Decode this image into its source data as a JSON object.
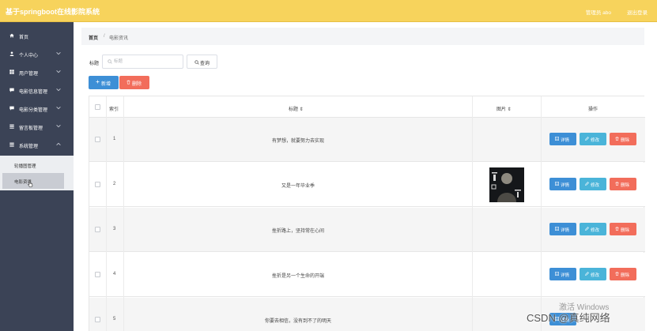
{
  "header": {
    "title": "基于springboot在线影院系统",
    "user_text": "管理员 abo",
    "logout_label": "退出登录",
    "background_color": "#f7d35c"
  },
  "sidebar": {
    "background_color": "#3b4356",
    "items": [
      {
        "label": "首页",
        "icon": "home-icon",
        "has_chevron": false
      },
      {
        "label": "个人中心",
        "icon": "user-icon",
        "has_chevron": true
      },
      {
        "label": "用户管理",
        "icon": "grid-icon",
        "has_chevron": true
      },
      {
        "label": "电影信息管理",
        "icon": "message-icon",
        "has_chevron": true
      },
      {
        "label": "电影分类管理",
        "icon": "message-icon",
        "has_chevron": true
      },
      {
        "label": "留言板管理",
        "icon": "list-icon",
        "has_chevron": true
      },
      {
        "label": "系统管理",
        "icon": "list-icon",
        "has_chevron": true
      }
    ],
    "submenu": [
      {
        "label": "轮播图管理",
        "active": false
      },
      {
        "label": "电影资讯",
        "active": true
      }
    ]
  },
  "breadcrumb": {
    "home": "首页",
    "separator": "/",
    "current": "电影资讯"
  },
  "search": {
    "label": "标题",
    "placeholder": "标题",
    "value": "",
    "button_label": "查询"
  },
  "toolbar": {
    "add_label": "新增",
    "delete_label": "删除"
  },
  "table": {
    "columns": {
      "index": "索引",
      "title": "标题 ⇕",
      "image": "图片 ⇕",
      "actions": "操作"
    },
    "action_labels": {
      "detail": "详情",
      "edit": "修改",
      "delete": "删除"
    },
    "rows": [
      {
        "index": "1",
        "title": "有梦想，就要努力去实现",
        "has_image": false
      },
      {
        "index": "2",
        "title": "又是一年毕业季",
        "has_image": true
      },
      {
        "index": "3",
        "title": "挫折路上，坚持常在心间",
        "has_image": false
      },
      {
        "index": "4",
        "title": "挫折是另一个生命的开端",
        "has_image": false
      },
      {
        "index": "5",
        "title": "你要去相信，没有到不了的明天",
        "has_image": false
      }
    ]
  },
  "overlay": {
    "activate_windows": "激活 Windows",
    "watermark": "CSDN @真纯网络"
  },
  "colors": {
    "primary": "#3d8fd6",
    "info": "#4ab4d9",
    "danger": "#f26d5b"
  }
}
